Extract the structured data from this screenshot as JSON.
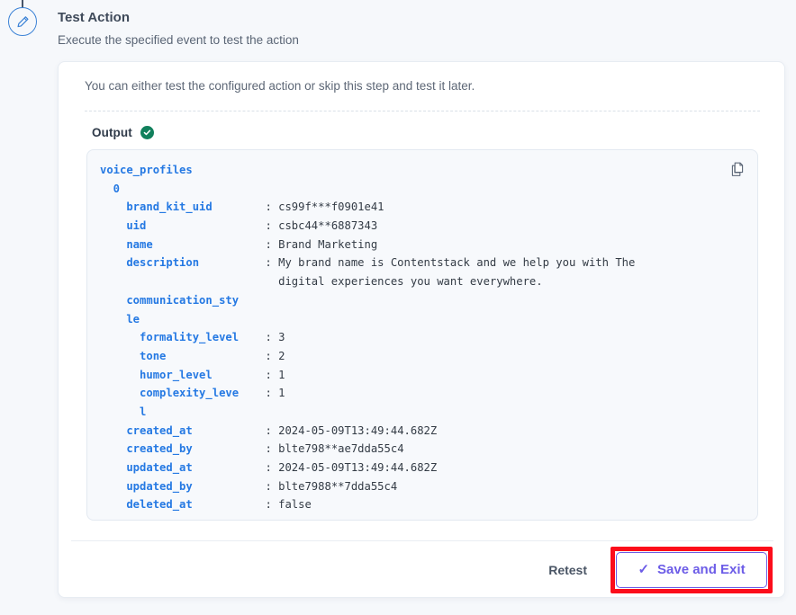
{
  "step": {
    "icon": "pencil-icon",
    "icon_color": "#3b82d6"
  },
  "header": {
    "title": "Test Action",
    "subtitle": "Execute the specified event to test the action"
  },
  "card": {
    "intro": "You can either test the configured action or skip this step and test it later.",
    "output_label": "Output",
    "status_icon": "check-circle-icon",
    "status_color": "#11805c"
  },
  "code_panel": {
    "copy_icon": "copy-icon",
    "key_color": "#2579e3",
    "value_color": "#333b45",
    "background": "#f7f9fc",
    "lines": [
      {
        "indent": 0,
        "key": "voice_profiles",
        "value": null
      },
      {
        "indent": 1,
        "key": "0",
        "value": null
      },
      {
        "indent": 2,
        "key": "brand_kit_uid",
        "value": "cs99f***f0901e41"
      },
      {
        "indent": 2,
        "key": "uid",
        "value": "csbc44**6887343"
      },
      {
        "indent": 2,
        "key": "name",
        "value": "Brand Marketing"
      },
      {
        "indent": 2,
        "key": "description",
        "value": "My brand name is Contentstack and we help you with The"
      },
      {
        "indent": 0,
        "key": null,
        "value": "digital experiences you want everywhere.",
        "continuation": true
      },
      {
        "indent": 2,
        "key": "communication_sty",
        "value": null
      },
      {
        "indent": 0,
        "key": "le",
        "value": null,
        "keywrap": true
      },
      {
        "indent": 3,
        "key": "formality_level",
        "value": "3"
      },
      {
        "indent": 3,
        "key": "tone",
        "value": "2"
      },
      {
        "indent": 3,
        "key": "humor_level",
        "value": "1"
      },
      {
        "indent": 3,
        "key": "complexity_leve",
        "value": "1"
      },
      {
        "indent": 0,
        "key": "l",
        "value": null,
        "keywrap2": true
      },
      {
        "indent": 2,
        "key": "created_at",
        "value": "2024-05-09T13:49:44.682Z"
      },
      {
        "indent": 2,
        "key": "created_by",
        "value": "blte798**ae7dda55c4"
      },
      {
        "indent": 2,
        "key": "updated_at",
        "value": "2024-05-09T13:49:44.682Z"
      },
      {
        "indent": 2,
        "key": "updated_by",
        "value": "blte7988**7dda55c4"
      },
      {
        "indent": 2,
        "key": "deleted_at",
        "value": "false"
      }
    ]
  },
  "footer": {
    "retest_label": "Retest",
    "save_label": "Save and Exit",
    "save_tick": "✓",
    "save_color": "#6c5ce7",
    "highlight_color": "#fc0d1b"
  }
}
